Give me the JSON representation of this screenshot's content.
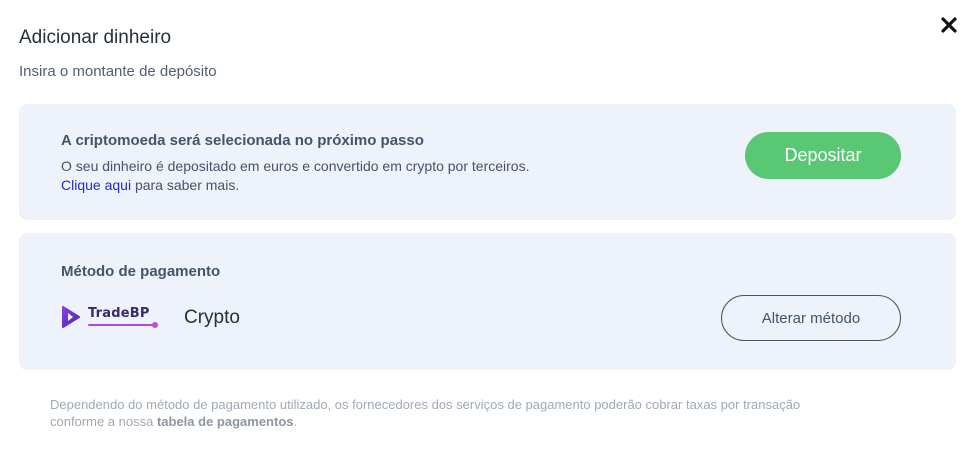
{
  "dialog": {
    "title": "Adicionar dinheiro",
    "subtitle": "Insira o montante de depósito",
    "close_icon": "close-icon"
  },
  "info_card": {
    "heading": "A criptomoeda será selecionada no próximo passo",
    "text_line1": "O seu dinheiro é depositado em euros e convertido em crypto por terceiros.",
    "link_text": "Clique aqui",
    "text_after_link": " para saber mais.",
    "deposit_button": "Depositar"
  },
  "payment_method": {
    "heading": "Método de pagamento",
    "brand_name": "TradeBP",
    "method_name": "Crypto",
    "change_button": "Alterar método"
  },
  "footnote": {
    "text_before": "Dependendo do método de pagamento utilizado, os fornecedores dos serviços de pagamento poderão cobrar taxas por transação conforme a nossa ",
    "link_text": "tabela de pagamentos",
    "text_after": "."
  },
  "colors": {
    "accent_green": "#5ac774",
    "card_background": "#eef2fa",
    "link_blue": "#1f2bd1",
    "brand_purple": "#6a2bd9"
  }
}
